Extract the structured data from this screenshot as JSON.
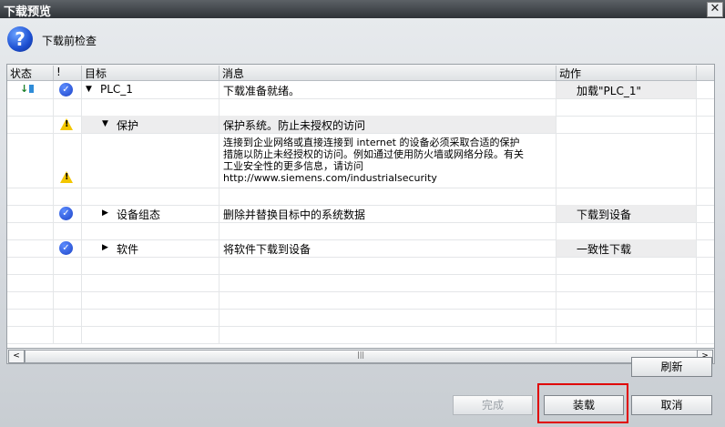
{
  "window": {
    "title": "下载预览",
    "close_glyph": "✕"
  },
  "header": {
    "label": "下载前检查",
    "icon_glyph": "?"
  },
  "columns": {
    "status": "状态",
    "bang": "!",
    "target": "目标",
    "message": "消息",
    "action": "动作"
  },
  "rows": [
    {
      "target": "PLC_1",
      "message": "下载准备就绪。",
      "action": "加载\"PLC_1\""
    },
    {
      "target": "保护",
      "message": "保护系统。防止未授权的访问"
    },
    {
      "message": "连接到企业网络或直接连接到 internet 的设备必须采取合适的保护\n措施以防止未经授权的访问。例如通过使用防火墙或网络分段。有关\n工业安全性的更多信息，请访问\nhttp://www.siemens.com/industrialsecurity"
    },
    {
      "target": "设备组态",
      "message": "删除并替换目标中的系统数据",
      "action": "下载到设备"
    },
    {
      "target": "软件",
      "message": "将软件下载到设备",
      "action": "一致性下载"
    }
  ],
  "scroll": {
    "left": "<",
    "right": ">",
    "grip": "|||"
  },
  "buttons": {
    "refresh": "刷新",
    "finish": "完成",
    "load": "装载",
    "cancel": "取消"
  },
  "colors": {
    "highlight": "#e00000",
    "ok": "#1d44c8",
    "warning": "#f3c600"
  }
}
